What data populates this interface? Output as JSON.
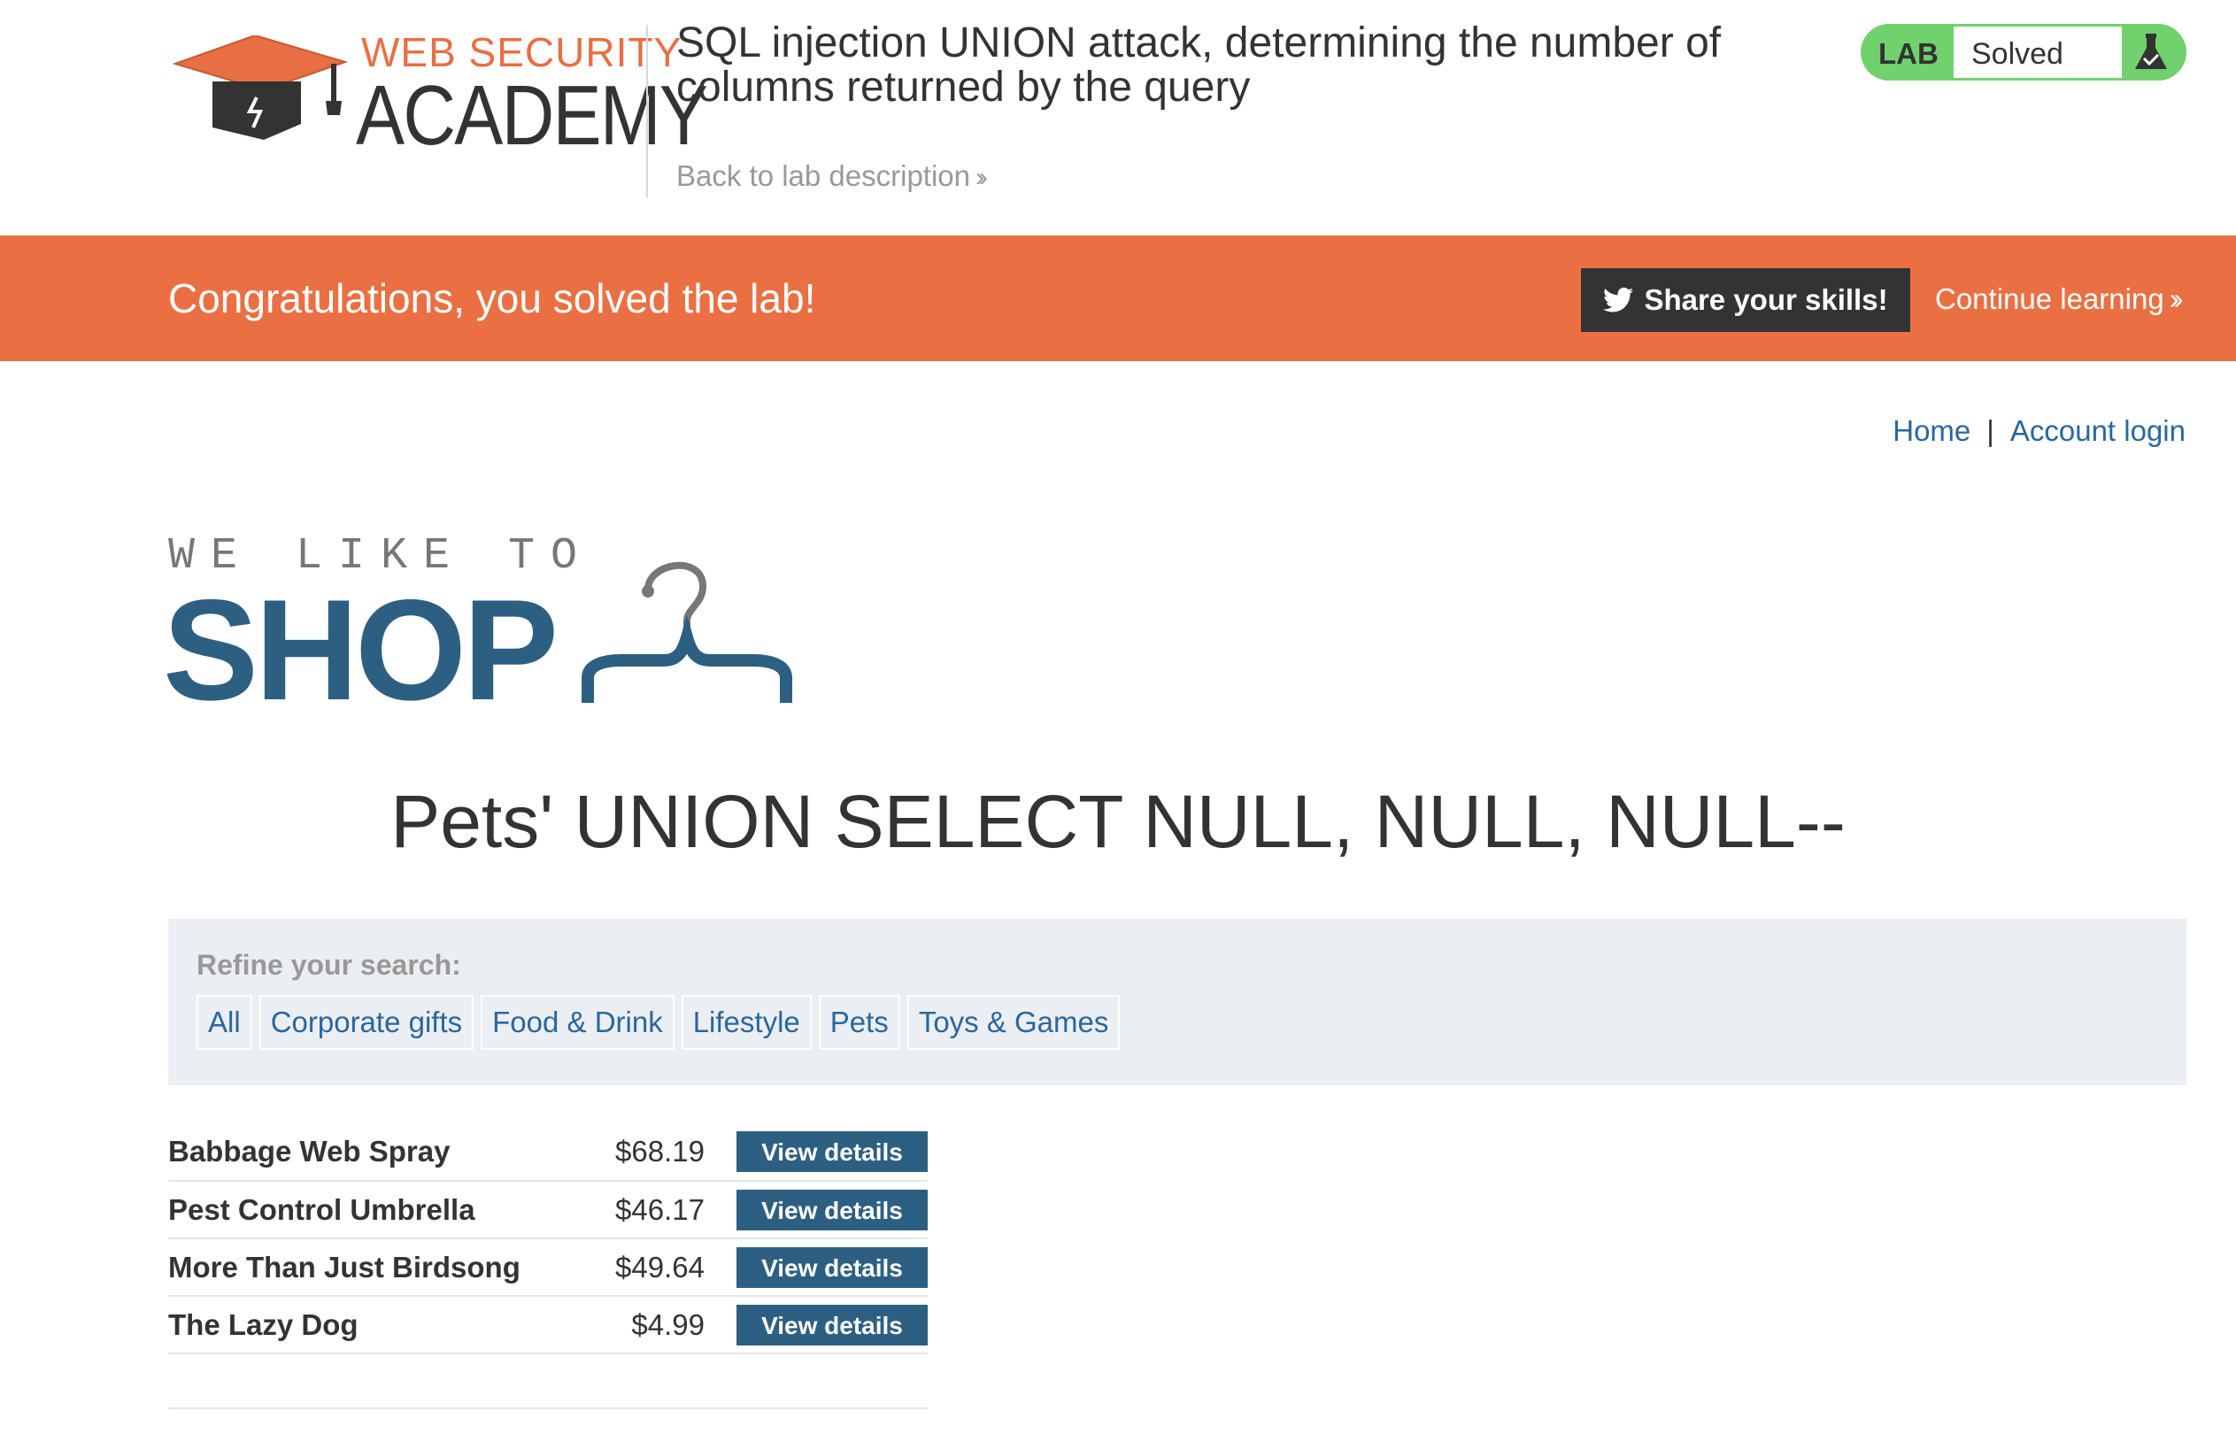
{
  "academy": {
    "logo_top": "WEB SECURITY",
    "logo_bottom": "ACADEMY",
    "lab_title": "SQL injection UNION attack, determining the number of columns returned by the query",
    "back_link": "Back to lab description",
    "lab_label": "LAB",
    "lab_status": "Solved"
  },
  "banner": {
    "message": "Congratulations, you solved the lab!",
    "share_label": "Share your skills!",
    "continue_label": "Continue learning"
  },
  "nav": {
    "home": "Home",
    "separator": "|",
    "account": "Account login"
  },
  "shop_logo": {
    "tagline": "WE LIKE TO",
    "word": "SHOP"
  },
  "search_heading": "Pets' UNION SELECT NULL, NULL, NULL--",
  "filters": {
    "label": "Refine your search:",
    "items": [
      "All",
      "Corporate gifts",
      "Food & Drink",
      "Lifestyle",
      "Pets",
      "Toys & Games"
    ]
  },
  "products": [
    {
      "name": "Babbage Web Spray",
      "price": "$68.19",
      "action": "View details"
    },
    {
      "name": "Pest Control Umbrella",
      "price": "$46.17",
      "action": "View details"
    },
    {
      "name": "More Than Just Birdsong",
      "price": "$49.64",
      "action": "View details"
    },
    {
      "name": "The Lazy Dog",
      "price": "$4.99",
      "action": "View details"
    }
  ],
  "colors": {
    "accent_orange": "#ea7043",
    "solved_green": "#70d16d",
    "shop_blue": "#2d5f82",
    "link_blue": "#29679e"
  }
}
